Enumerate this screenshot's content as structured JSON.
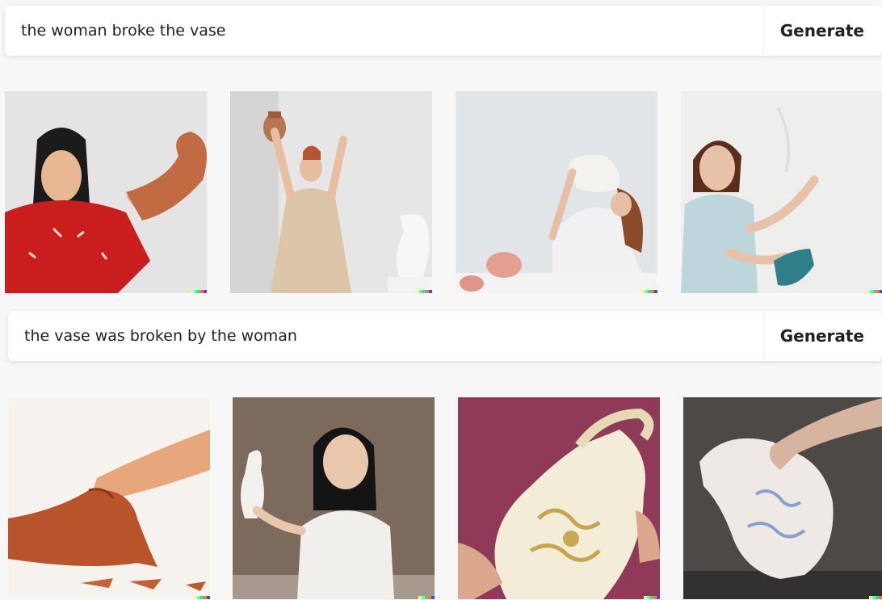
{
  "rows": [
    {
      "prompt": "the woman broke the vase",
      "button_label": "Generate"
    },
    {
      "prompt": "the vase was broken by the woman",
      "button_label": "Generate"
    }
  ],
  "watermark_colors": [
    "#ffff66",
    "#42ffff",
    "#51da4c",
    "#ff6e3c",
    "#3c46ff"
  ]
}
